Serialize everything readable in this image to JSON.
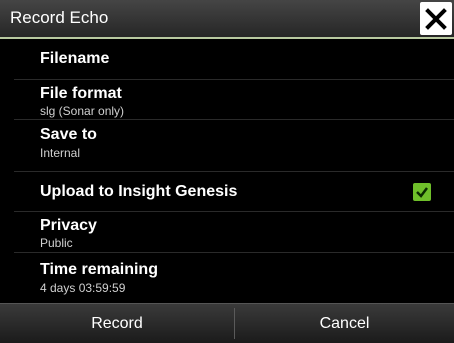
{
  "window": {
    "title": "Record Echo"
  },
  "rows": [
    {
      "label": "Filename",
      "value": ""
    },
    {
      "label": "File format",
      "value": "slg (Sonar only)"
    },
    {
      "label": "Save to",
      "value": "Internal"
    },
    {
      "label": "Upload to Insight Genesis",
      "value": "",
      "checked": true
    },
    {
      "label": "Privacy",
      "value": "Public"
    },
    {
      "label": "Time remaining",
      "value": "4 days 03:59:59"
    }
  ],
  "footer": {
    "record_label": "Record",
    "cancel_label": "Cancel"
  },
  "colors": {
    "accent_line": "#b8c9a0",
    "checkbox": "#6fbf2a"
  },
  "icons": {
    "close": "close-icon",
    "check": "checkmark-icon"
  }
}
